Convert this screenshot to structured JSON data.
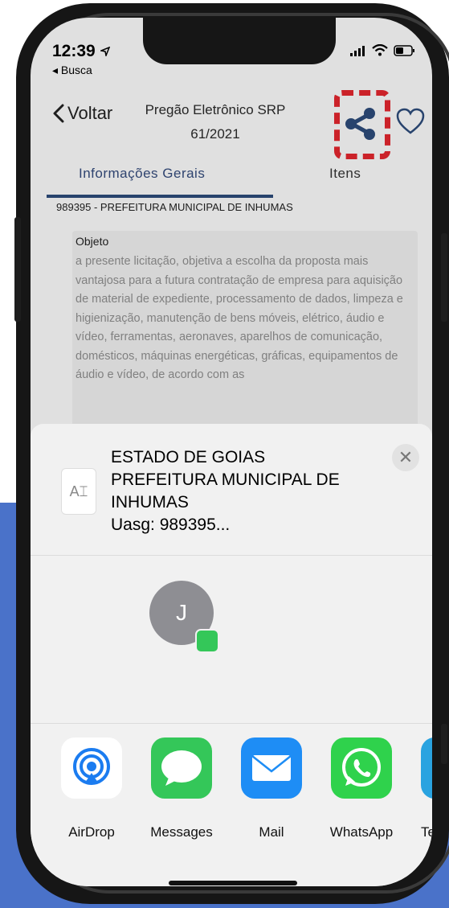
{
  "status": {
    "time": "12:39",
    "back_label": "◂ Busca"
  },
  "nav": {
    "back_label": "Voltar",
    "title_line1": "Pregão Eletrônico SRP",
    "title_line2": "61/2021"
  },
  "tabs": [
    {
      "label": "Informações Gerais",
      "active": true
    },
    {
      "label": "Itens",
      "active": false
    }
  ],
  "organization": "989395 - PREFEITURA MUNICIPAL DE INHUMAS",
  "objeto": {
    "label": "Objeto",
    "text": "a presente licitação, objetiva a escolha da proposta mais vantajosa para a futura contratação de empresa para aquisição de material de expediente, processamento de dados, limpeza e higienização, manutenção de bens móveis, elétrico, áudio e vídeo, ferramentas, aeronaves, aparelhos de comunicação, domésticos, máquinas energéticas, gráficas, equipamentos de áudio e vídeo, de acordo com as"
  },
  "share_sheet": {
    "line1": "ESTADO DE GOIAS",
    "line2": "PREFEITURA MUNICIPAL DE",
    "line3": "INHUMAS",
    "line4": "Uasg: 989395...",
    "contact_initial": "J",
    "apps": [
      {
        "label": "AirDrop",
        "icon": "airdrop-icon"
      },
      {
        "label": "Messages",
        "icon": "messages-icon"
      },
      {
        "label": "Mail",
        "icon": "mail-icon"
      },
      {
        "label": "WhatsApp",
        "icon": "whatsapp-icon"
      },
      {
        "label": "Te",
        "icon": "telegram-icon"
      }
    ]
  },
  "colors": {
    "accent_blue": "#2c4a78",
    "highlight_red": "#e0262e",
    "background_blue": "#4a72c9"
  }
}
